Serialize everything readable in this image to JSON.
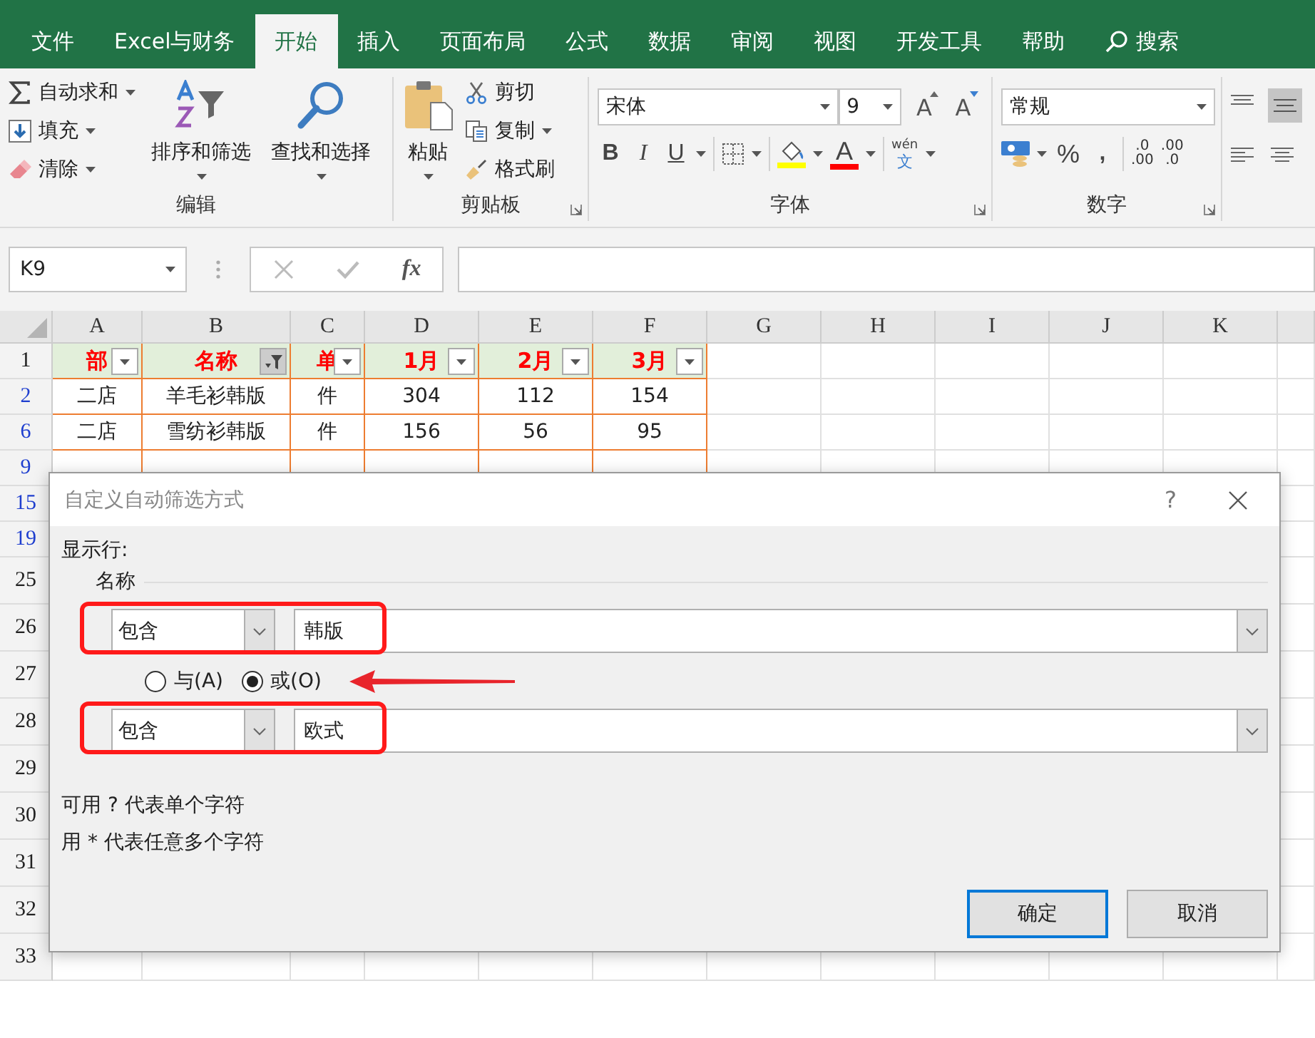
{
  "tabs": [
    {
      "label": "文件",
      "selected": false
    },
    {
      "label": "Excel与财务",
      "selected": false
    },
    {
      "label": "开始",
      "selected": true
    },
    {
      "label": "插入",
      "selected": false
    },
    {
      "label": "页面布局",
      "selected": false
    },
    {
      "label": "公式",
      "selected": false
    },
    {
      "label": "数据",
      "selected": false
    },
    {
      "label": "审阅",
      "selected": false
    },
    {
      "label": "视图",
      "selected": false
    },
    {
      "label": "开发工具",
      "selected": false
    },
    {
      "label": "帮助",
      "selected": false
    }
  ],
  "search": {
    "label": "搜索"
  },
  "editing_group": {
    "title": "编辑",
    "autosum": "自动求和",
    "fill": "填充",
    "clear": "清除",
    "sort_filter": "排序和筛选",
    "find_select": "查找和选择"
  },
  "clipboard_group": {
    "title": "剪贴板",
    "paste": "粘贴",
    "cut": "剪切",
    "copy": "复制",
    "format_painter": "格式刷"
  },
  "font_group": {
    "title": "字体",
    "font_name": "宋体",
    "font_size": "9",
    "grow_font": "A",
    "shrink_font": "A",
    "bold": "B",
    "italic": "I",
    "underline": "U",
    "font_color": "A",
    "phonetic_top": "wén",
    "phonetic_bottom": "文"
  },
  "number_group": {
    "title": "数字",
    "format": "常规",
    "percent": "%",
    "comma": ",",
    "increase_decimal": [
      ".0",
      ".00"
    ],
    "decrease_decimal": [
      ".00",
      ".0"
    ]
  },
  "formula_bar": {
    "name_box": "K9",
    "fx": "fx"
  },
  "sheet": {
    "columns": [
      "A",
      "B",
      "C",
      "D",
      "E",
      "F",
      "G",
      "H",
      "I",
      "J",
      "K"
    ],
    "header_row": {
      "num": "1",
      "cells": [
        {
          "text": "部",
          "filtered": false
        },
        {
          "text": "名称",
          "filtered": true
        },
        {
          "text": "单",
          "filtered": false
        },
        {
          "text": "1月",
          "filtered": false
        },
        {
          "text": "2月",
          "filtered": false
        },
        {
          "text": "3月",
          "filtered": false
        }
      ]
    },
    "rows": [
      {
        "num": "2",
        "filtered": true,
        "cells": [
          "二店",
          "羊毛衫韩版",
          "件",
          "304",
          "112",
          "154"
        ]
      },
      {
        "num": "6",
        "filtered": true,
        "cells": [
          "二店",
          "雪纺衫韩版",
          "件",
          "156",
          "56",
          "95"
        ]
      },
      {
        "num": "9",
        "filtered": true,
        "cells": []
      },
      {
        "num": "15",
        "filtered": true,
        "cells": []
      },
      {
        "num": "19",
        "filtered": true,
        "cells": []
      },
      {
        "num": "25",
        "filtered": false,
        "cells": []
      },
      {
        "num": "26",
        "filtered": false,
        "cells": []
      },
      {
        "num": "27",
        "filtered": false,
        "cells": []
      },
      {
        "num": "28",
        "filtered": false,
        "cells": []
      },
      {
        "num": "29",
        "filtered": false,
        "cells": []
      },
      {
        "num": "30",
        "filtered": false,
        "cells": []
      },
      {
        "num": "31",
        "filtered": false,
        "cells": []
      },
      {
        "num": "32",
        "filtered": false,
        "cells": []
      },
      {
        "num": "33",
        "filtered": false,
        "cells": []
      }
    ]
  },
  "dialog": {
    "title": "自定义自动筛选方式",
    "help": "?",
    "show_rows": "显示行:",
    "field": "名称",
    "conditions": [
      {
        "operator": "包含",
        "value": "韩版",
        "highlighted": true
      },
      {
        "operator": "包含",
        "value": "欧式",
        "highlighted": true
      }
    ],
    "logic": [
      {
        "label": "与(A)",
        "selected": false,
        "arrow": false
      },
      {
        "label": "或(O)",
        "selected": true,
        "arrow": true
      }
    ],
    "hints": [
      "可用 ? 代表单个字符",
      "用 * 代表任意多个字符"
    ],
    "buttons": [
      {
        "label": "确定",
        "default": true
      },
      {
        "label": "取消",
        "default": false
      }
    ]
  }
}
